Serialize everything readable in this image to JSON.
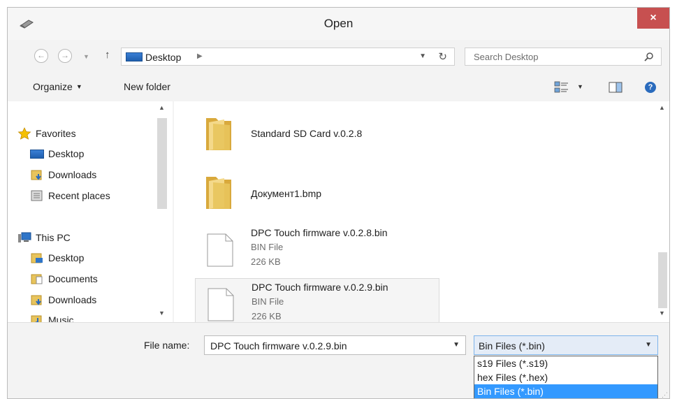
{
  "window": {
    "title": "Open",
    "close_label": "×"
  },
  "nav": {
    "back": "←",
    "forward": "→",
    "up": "↑",
    "address": "Desktop",
    "search_placeholder": "Search Desktop"
  },
  "toolbar": {
    "organize": "Organize",
    "new_folder": "New folder",
    "help": "?"
  },
  "sidebar": {
    "favorites": "Favorites",
    "fav_items": [
      "Desktop",
      "Downloads",
      "Recent places"
    ],
    "this_pc": "This PC",
    "pc_items": [
      "Desktop",
      "Documents",
      "Downloads",
      "Music"
    ]
  },
  "files": [
    {
      "name": "Standard SD Card v.0.2.8",
      "kind": "folder"
    },
    {
      "name": "Документ1.bmp",
      "kind": "folder"
    },
    {
      "name": "DPC Touch firmware v.0.2.8.bin",
      "type": "BIN File",
      "size": "226 KB"
    },
    {
      "name": "DPC Touch firmware v.0.2.9.bin",
      "type": "BIN File",
      "size": "226 KB",
      "selected": true
    }
  ],
  "footer": {
    "file_name_label": "File name:",
    "file_name_value": "DPC Touch firmware v.0.2.9.bin",
    "file_type_value": "Bin Files (*.bin)",
    "file_type_options": [
      "s19 Files (*.s19)",
      "hex Files (*.hex)",
      "Bin Files (*.bin)"
    ]
  },
  "colors": {
    "close": "#c75050",
    "selection": "#3399ff",
    "folder": "#e8c45c"
  }
}
